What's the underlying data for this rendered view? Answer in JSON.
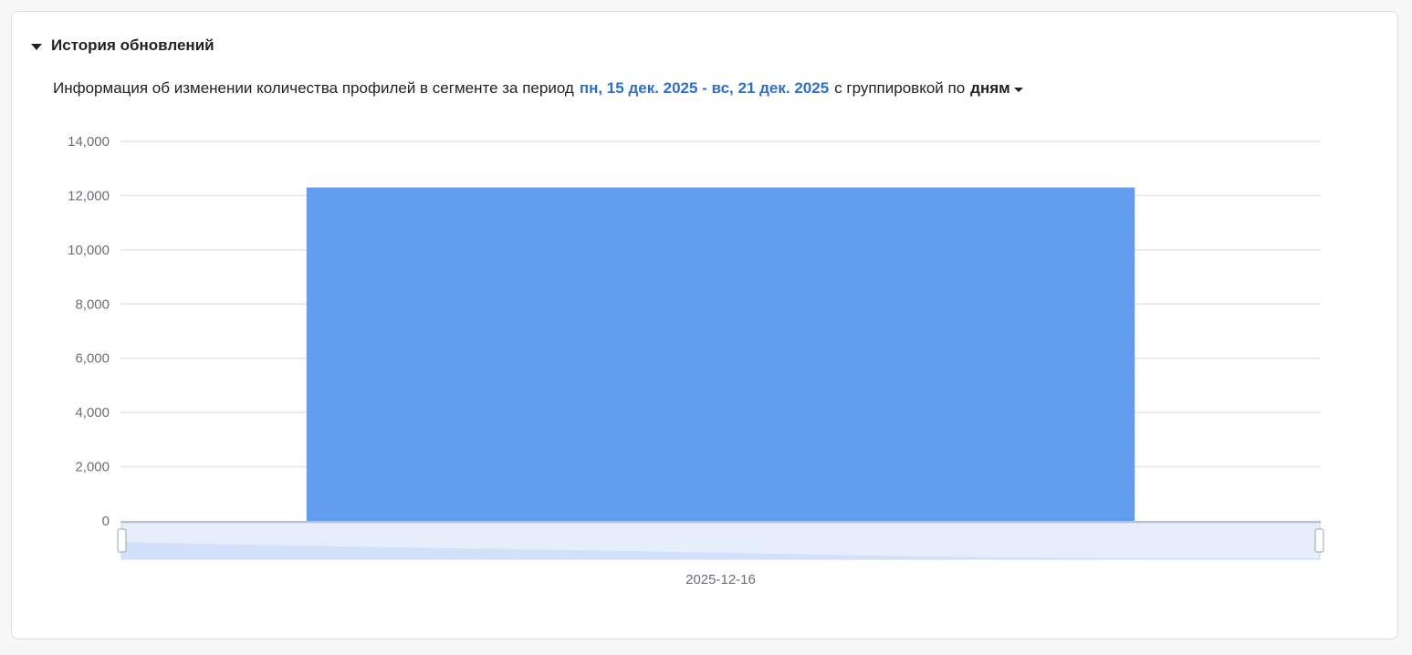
{
  "section": {
    "title": "История обновлений"
  },
  "info": {
    "prefix": "Информация об изменении количества профилей в сегменте за период",
    "period": "пн, 15 дек. 2025 - вс, 21 дек. 2025",
    "grouping_prefix": "с группировкой по",
    "grouping_value": "дням"
  },
  "colors": {
    "bar": "#619cee",
    "link": "#2d6fd0",
    "grid": "#e4e5ea"
  },
  "chart_data": {
    "type": "bar",
    "categories": [
      "2025-12-16"
    ],
    "values": [
      12300
    ],
    "ylim": [
      0,
      14000
    ],
    "yticks": [
      "14,000",
      "12,000",
      "10,000",
      "8,000",
      "6,000",
      "4,000",
      "2,000",
      "0"
    ],
    "ytick_values": [
      14000,
      12000,
      10000,
      8000,
      6000,
      4000,
      2000,
      0
    ],
    "grid": true,
    "data_zoom": true
  }
}
